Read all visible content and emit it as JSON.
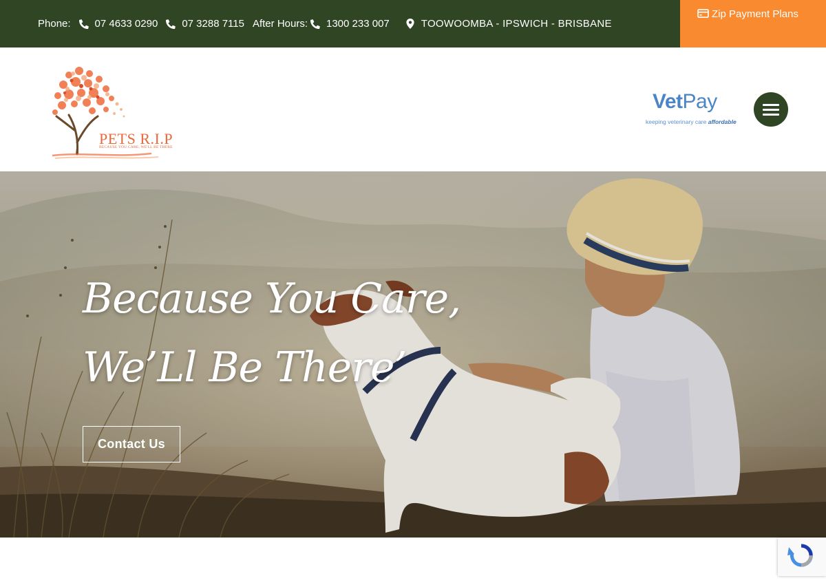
{
  "topbar": {
    "phone_label": "Phone:",
    "phone_1": "07 4633 0290",
    "phone_2": "07 3288 7115",
    "after_hours_label": "After Hours:",
    "after_hours_phone": "1300 233 007",
    "locations": "TOOWOOMBA - IPSWICH - BRISBANE",
    "zip_label": "Zip Payment Plans",
    "bg_color": "#2f4524",
    "accent_color": "#f98a2f"
  },
  "header": {
    "logo_name": "PETS R.I.P",
    "logo_tagline": "BECAUSE YOU CARE, WE'LL BE THERE",
    "vetpay_name_bold": "Vet",
    "vetpay_name_light": "Pay",
    "vetpay_tagline": "keeping veterinary care",
    "vetpay_tagline_emphasis": "affordable",
    "menu_icon": "hamburger-icon"
  },
  "hero": {
    "headline_line1": "Because You Care,",
    "headline_line2": "We’Ll Be There’",
    "cta_label": "Contact Us"
  },
  "icons": {
    "phone": "phone-icon",
    "location": "map-pin-icon",
    "card": "credit-card-icon"
  }
}
